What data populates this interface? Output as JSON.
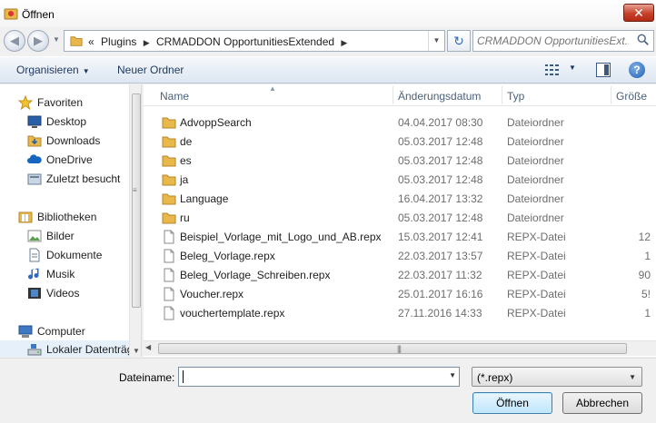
{
  "window": {
    "title": "Öffnen",
    "close_label": "✕"
  },
  "navigation": {
    "breadcrumbs": [
      "«",
      "Plugins",
      "CRMADDON OpportunitiesExtended"
    ],
    "search_placeholder": "CRMADDON OpportunitiesExt..."
  },
  "toolbar": {
    "organize_label": "Organisieren",
    "new_folder_label": "Neuer Ordner",
    "help_label": "?"
  },
  "sidebar": {
    "favorites": "Favoriten",
    "favorite_items": [
      "Desktop",
      "Downloads",
      "OneDrive",
      "Zuletzt besucht"
    ],
    "libraries": "Bibliotheken",
    "library_items": [
      "Bilder",
      "Dokumente",
      "Musik",
      "Videos"
    ],
    "computer": "Computer",
    "computer_items": [
      "Lokaler Datenträg"
    ]
  },
  "file_list": {
    "columns": [
      "Name",
      "Änderungsdatum",
      "Typ",
      "Größe"
    ],
    "rows": [
      {
        "name": "AdvoppSearch",
        "date": "04.04.2017 08:30",
        "type": "Dateiordner",
        "size": "",
        "icon": "folder-icon"
      },
      {
        "name": "de",
        "date": "05.03.2017 12:48",
        "type": "Dateiordner",
        "size": "",
        "icon": "folder-icon"
      },
      {
        "name": "es",
        "date": "05.03.2017 12:48",
        "type": "Dateiordner",
        "size": "",
        "icon": "folder-icon"
      },
      {
        "name": "ja",
        "date": "05.03.2017 12:48",
        "type": "Dateiordner",
        "size": "",
        "icon": "folder-icon"
      },
      {
        "name": "Language",
        "date": "16.04.2017 13:32",
        "type": "Dateiordner",
        "size": "",
        "icon": "folder-icon"
      },
      {
        "name": "ru",
        "date": "05.03.2017 12:48",
        "type": "Dateiordner",
        "size": "",
        "icon": "folder-icon"
      },
      {
        "name": "Beispiel_Vorlage_mit_Logo_und_AB.repx",
        "date": "15.03.2017 12:41",
        "type": "REPX-Datei",
        "size": "12",
        "icon": "file-icon"
      },
      {
        "name": "Beleg_Vorlage.repx",
        "date": "22.03.2017 13:57",
        "type": "REPX-Datei",
        "size": "1",
        "icon": "file-icon"
      },
      {
        "name": "Beleg_Vorlage_Schreiben.repx",
        "date": "22.03.2017 11:32",
        "type": "REPX-Datei",
        "size": "90",
        "icon": "file-icon"
      },
      {
        "name": "Voucher.repx",
        "date": "25.01.2017 16:16",
        "type": "REPX-Datei",
        "size": "5!",
        "icon": "file-icon"
      },
      {
        "name": "vouchertemplate.repx",
        "date": "27.11.2016 14:33",
        "type": "REPX-Datei",
        "size": "1",
        "icon": "file-icon"
      }
    ]
  },
  "footer": {
    "filename_label": "Dateiname:",
    "filename_value": "",
    "filter_value": "(*.repx)",
    "open_label": "Öffnen",
    "cancel_label": "Abbrechen"
  },
  "colors": {
    "accent": "#3c7fb1",
    "folder": "#e8b94a",
    "close": "#c7402a"
  }
}
